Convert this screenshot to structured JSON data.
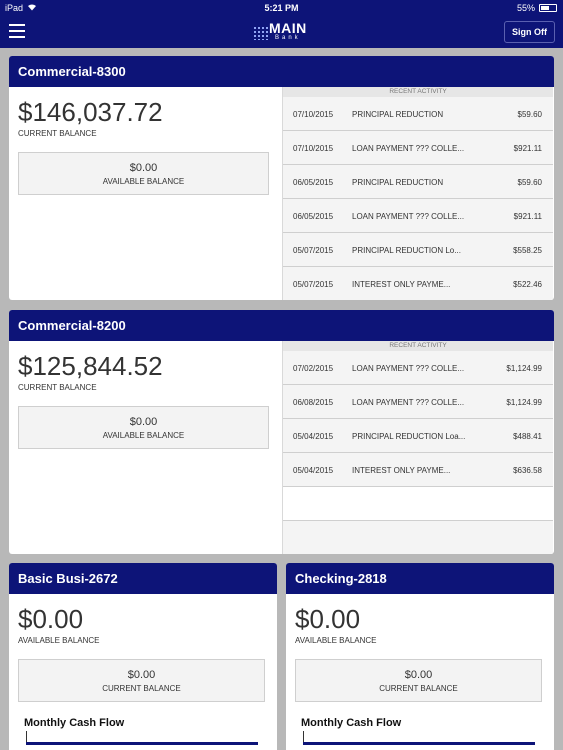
{
  "status": {
    "device": "iPad",
    "time": "5:21 PM",
    "battery": "55%",
    "battery_level": 0.55
  },
  "header": {
    "logo_main": "MAIN",
    "logo_sub": "Bank",
    "signoff_label": "Sign Off"
  },
  "accounts": [
    {
      "name": "Commercial-8300",
      "balance": "$146,037.72",
      "balance_label": "CURRENT BALANCE",
      "box_value": "$0.00",
      "box_label": "AVAILABLE BALANCE",
      "activity_title": "RECENT ACTIVITY",
      "activity": [
        {
          "date": "07/10/2015",
          "desc": "PRINCIPAL REDUCTION",
          "amount": "$59.60"
        },
        {
          "date": "07/10/2015",
          "desc": "LOAN PAYMENT ??? COLLE...",
          "amount": "$921.11"
        },
        {
          "date": "06/05/2015",
          "desc": "PRINCIPAL REDUCTION",
          "amount": "$59.60"
        },
        {
          "date": "06/05/2015",
          "desc": "LOAN PAYMENT ??? COLLE...",
          "amount": "$921.11"
        },
        {
          "date": "05/07/2015",
          "desc": "PRINCIPAL REDUCTION Lo...",
          "amount": "$558.25"
        },
        {
          "date": "05/07/2015",
          "desc": "INTEREST ONLY PAYME...",
          "amount": "$522.46"
        }
      ]
    },
    {
      "name": "Commercial-8200",
      "balance": "$125,844.52",
      "balance_label": "CURRENT BALANCE",
      "box_value": "$0.00",
      "box_label": "AVAILABLE BALANCE",
      "activity_title": "RECENT ACTIVITY",
      "activity": [
        {
          "date": "07/02/2015",
          "desc": "LOAN PAYMENT ??? COLLE...",
          "amount": "$1,124.99"
        },
        {
          "date": "06/08/2015",
          "desc": "LOAN PAYMENT ??? COLLE...",
          "amount": "$1,124.99"
        },
        {
          "date": "05/04/2015",
          "desc": "PRINCIPAL REDUCTION Loa...",
          "amount": "$488.41"
        },
        {
          "date": "05/04/2015",
          "desc": "INTEREST ONLY PAYME...",
          "amount": "$636.58"
        }
      ]
    },
    {
      "name": "Basic Busi-2672",
      "balance": "$0.00",
      "balance_label": "AVAILABLE BALANCE",
      "box_value": "$0.00",
      "box_label": "CURRENT BALANCE",
      "cash_flow_title": "Monthly Cash Flow"
    },
    {
      "name": "Checking-2818",
      "balance": "$0.00",
      "balance_label": "AVAILABLE BALANCE",
      "box_value": "$0.00",
      "box_label": "CURRENT BALANCE",
      "cash_flow_title": "Monthly Cash Flow"
    }
  ],
  "colors": {
    "nav": "#0d1478",
    "page_bg": "#b8b8b8",
    "activity_bg": "#f4f4f4"
  }
}
